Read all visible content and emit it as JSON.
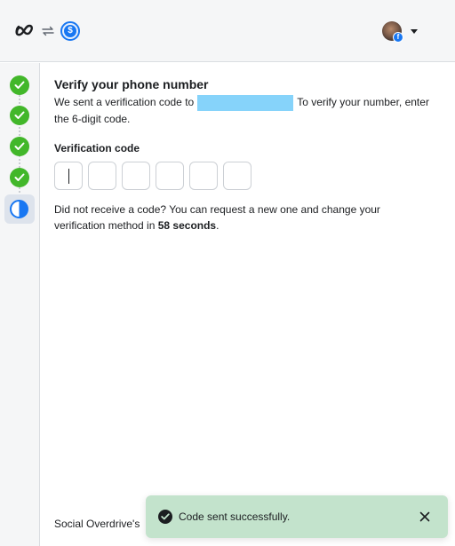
{
  "header": {
    "logo_icon": "meta-logo-icon",
    "switch_icon": "switch-accounts-icon",
    "billing_icon": "billing-icon",
    "billing_symbol": "$",
    "fb_badge": "f",
    "brand_color": "#1877f2"
  },
  "stepper": {
    "steps": [
      {
        "state": "complete",
        "icon": "check-circle-icon"
      },
      {
        "state": "complete",
        "icon": "check-circle-icon"
      },
      {
        "state": "complete",
        "icon": "check-circle-icon"
      },
      {
        "state": "complete",
        "icon": "check-circle-icon"
      },
      {
        "state": "current",
        "icon": "half-circle-icon"
      }
    ],
    "complete_color": "#42b72a"
  },
  "verify": {
    "title": "Verify your phone number",
    "desc_before": "We sent a verification code to",
    "desc_after": "To verify your number, enter the 6-digit code.",
    "code_label": "Verification code",
    "code_digits": [
      "",
      "",
      "",
      "",
      "",
      ""
    ],
    "resend_before": "Did not receive a code? You can request a new one and change your verification method in",
    "resend_countdown": "58 seconds",
    "resend_after": "."
  },
  "footer": {
    "text": "Social Overdrive's"
  },
  "toast": {
    "message": "Code sent successfully.",
    "icon": "check-circle-icon",
    "close_icon": "close-icon",
    "background": "#c3e3cc"
  }
}
